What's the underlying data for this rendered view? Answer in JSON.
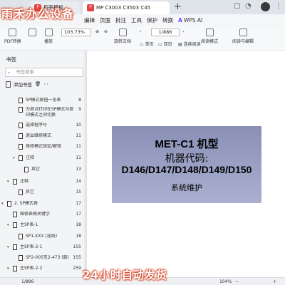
{
  "watermark": {
    "top": "雨禾办公设备",
    "bottom": "24小时自动发货"
  },
  "tabs": [
    {
      "label": "稻壳模板"
    },
    {
      "label": "MP C3003 C3503 C45"
    }
  ],
  "menu": [
    "编辑",
    "页面",
    "批注",
    "工具",
    "保护",
    "转换"
  ],
  "wps_ai": "WPS AI",
  "toolbar": {
    "zoom": "103.73%",
    "page": "1/886",
    "pdf_convert": "PDF转换",
    "play": "播放",
    "rotate_doc": "旋转文档",
    "single_page": "单页",
    "double_page": "双页",
    "continuous_read": "连续阅读",
    "read_mode": "阅读模式",
    "read_edit": "阅读与编辑"
  },
  "sidebar": {
    "title": "书签",
    "search_placeholder": "书签搜索",
    "add_bookmark": "添加书签",
    "items": [
      {
        "label": "SP模式按钮一览表",
        "page": "8"
      },
      {
        "label": "为测试打印在SP模式与复印模式之间切换",
        "page": "9"
      },
      {
        "label": "选择程序号",
        "page": "10"
      },
      {
        "label": "退出维修模式",
        "page": "11"
      },
      {
        "label": "维修模式锁定/解锁",
        "page": "11"
      },
      {
        "label": "注释",
        "page": "11"
      },
      {
        "label": "其它",
        "page": "13"
      },
      {
        "label": "注释",
        "page": "14"
      },
      {
        "label": "其它",
        "page": "15"
      },
      {
        "label": "2. SP模式表",
        "page": "17"
      },
      {
        "label": "维修表格关键字",
        "page": "17"
      },
      {
        "label": "主SP表-1",
        "page": "18"
      },
      {
        "label": "SP1-XXX (送纸)",
        "page": "18"
      },
      {
        "label": "主SP表-2-1",
        "page": "155"
      },
      {
        "label": "SP2-005至2-473 (鼓)",
        "page": "155"
      },
      {
        "label": "主SP表-2-2",
        "page": "259"
      }
    ]
  },
  "document": {
    "cover_line1": "MET-C1 机型",
    "cover_line2": "机器代码:",
    "cover_line3": "D146/D147/D148/D149/D150",
    "cover_line4": "系统维护"
  },
  "statusbar": {
    "page": "1/886",
    "zoom": "104%"
  }
}
